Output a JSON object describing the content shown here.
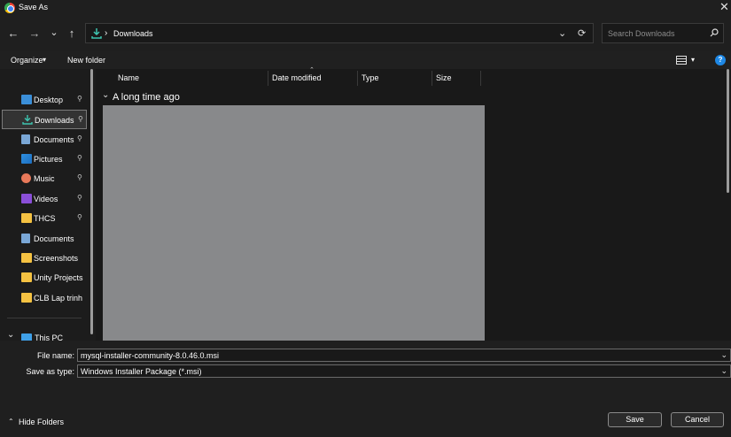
{
  "window": {
    "title": "Save As",
    "close_icon": "✕"
  },
  "nav": {
    "back_icon": "←",
    "forward_icon": "→",
    "recent_icon": "⌄",
    "up_icon": "↑",
    "address_separator": "›",
    "address": "Downloads",
    "address_dropdown_icon": "⌄",
    "refresh_icon": "⟳",
    "search_placeholder": "Search Downloads"
  },
  "toolbar": {
    "organize": "Organize",
    "organize_caret": "▾",
    "new_folder": "New folder",
    "view_caret": "▾",
    "help": "?"
  },
  "sidebar": {
    "items": [
      {
        "label": "Desktop",
        "icon": "desktop-icon",
        "pinned": true
      },
      {
        "label": "Downloads",
        "icon": "download-icon",
        "pinned": true,
        "selected": true
      },
      {
        "label": "Documents",
        "icon": "documents-icon",
        "pinned": true
      },
      {
        "label": "Pictures",
        "icon": "pictures-icon",
        "pinned": true
      },
      {
        "label": "Music",
        "icon": "music-icon",
        "pinned": true
      },
      {
        "label": "Videos",
        "icon": "videos-icon",
        "pinned": true
      },
      {
        "label": "THCS",
        "icon": "folder-icon",
        "pinned": true
      },
      {
        "label": "Documents",
        "icon": "folder-icon",
        "pinned": false
      },
      {
        "label": "Screenshots",
        "icon": "folder-icon",
        "pinned": false
      },
      {
        "label": "Unity Projects",
        "icon": "folder-icon",
        "pinned": false
      },
      {
        "label": "CLB Lap trinh",
        "icon": "folder-icon",
        "pinned": false
      }
    ],
    "this_pc": "This PC",
    "pin_glyph": "📌",
    "expand_glyph": "⌄"
  },
  "columns": {
    "name": "Name",
    "date": "Date modified",
    "type": "Type",
    "size": "Size",
    "sort_indicator": "⌃"
  },
  "group": {
    "label": "A long time ago",
    "toggle": "⌄"
  },
  "form": {
    "file_name_label": "File name:",
    "file_name_value": "mysql-installer-community-8.0.46.0.msi",
    "save_type_label": "Save as type:",
    "save_type_value": "Windows Installer Package (*.msi)",
    "dropdown_glyph": "⌄"
  },
  "footer": {
    "hide_folders": "Hide Folders",
    "hide_caret": "⌃",
    "save": "Save",
    "cancel": "Cancel"
  },
  "colors": {
    "accent": "#3ec4b0",
    "selected_bg": "#333333",
    "thumbnail": "#88898b",
    "folder": "#f5c242",
    "help": "#1e88e5"
  }
}
